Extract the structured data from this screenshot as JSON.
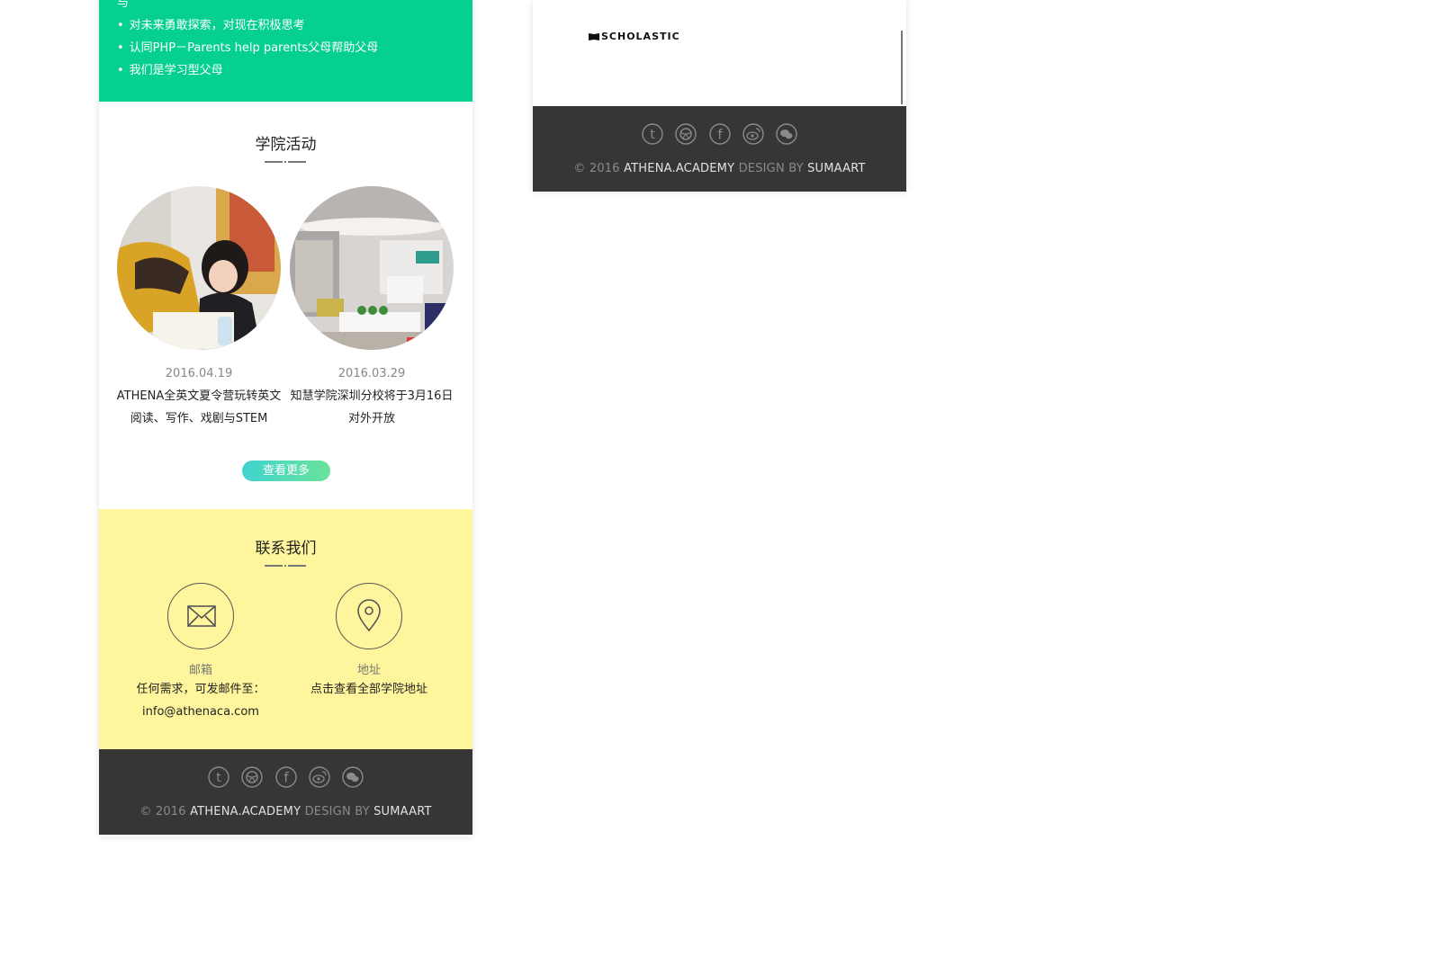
{
  "left_phone": {
    "intro": {
      "truncated_line": "与",
      "bullets": [
        "对未来勇敢探索，对现在积极思考",
        "认同PHP－Parents help parents父母帮助父母",
        "我们是学习型父母"
      ]
    },
    "activities": {
      "title": "学院活动",
      "items": [
        {
          "date": "2016.04.19",
          "title": "ATHENA全英文夏令营玩转英文阅读、写作、戏剧与STEM"
        },
        {
          "date": "2016.03.29",
          "title": "知慧学院深圳分校将于3月16日对外开放"
        }
      ],
      "more_button": "查看更多"
    },
    "contact": {
      "title": "联系我们",
      "email": {
        "label": "邮箱",
        "line1": "任何需求，可发邮件至：",
        "line2": "info@athenaca.com"
      },
      "address": {
        "label": "地址",
        "line1": "点击查看全部学院地址"
      }
    },
    "footer": {
      "copyright_prefix": "© 2016 ",
      "brand": "ATHENA.ACADEMY",
      "design_by": " DESIGN BY ",
      "designer": "SUMAART"
    }
  },
  "right_phone": {
    "partner_logo": "SCHOLASTIC",
    "footer": {
      "copyright_prefix": "© 2016 ",
      "brand": "ATHENA.ACADEMY",
      "design_by": " DESIGN BY ",
      "designer": "SUMAART"
    }
  },
  "social_icons": [
    "tumblr-icon",
    "dribbble-icon",
    "facebook-icon",
    "weibo-icon",
    "wechat-icon"
  ],
  "colors": {
    "green": "#06d08f",
    "yellow": "#fff59d",
    "footer": "#363636",
    "button_gradient_start": "#40d4d0",
    "button_gradient_end": "#69e29a"
  }
}
